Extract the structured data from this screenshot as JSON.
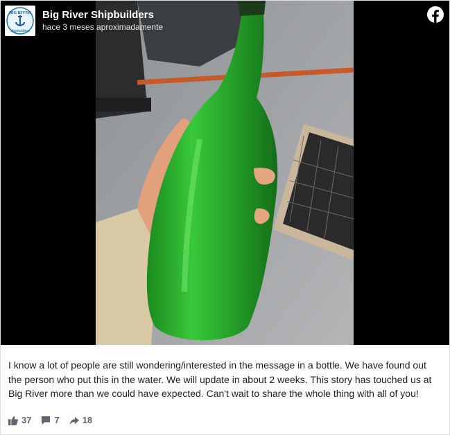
{
  "header": {
    "page_name": "Big River Shipbuilders",
    "timestamp": "hace 3 meses aproximadamente",
    "logo_lettering": "BIG RIVER Shipbuilders"
  },
  "post": {
    "caption": "I know a lot of people are still wondering/interested in the message in a bottle. We have found out the person who put this in the water. We will update in about 2 weeks. This story has touched us at Big River more than we could have expected. Can't wait to share the whole thing with all of you!"
  },
  "stats": {
    "likes": "37",
    "comments": "7",
    "shares": "18"
  },
  "icons": {
    "platform": "facebook-icon",
    "like": "thumbs-up-icon",
    "comment": "comment-icon",
    "share": "share-arrow-icon"
  },
  "colors": {
    "facebook": "#ffffff",
    "bottle_green": "#2bb531",
    "footer_text": "#606770"
  }
}
